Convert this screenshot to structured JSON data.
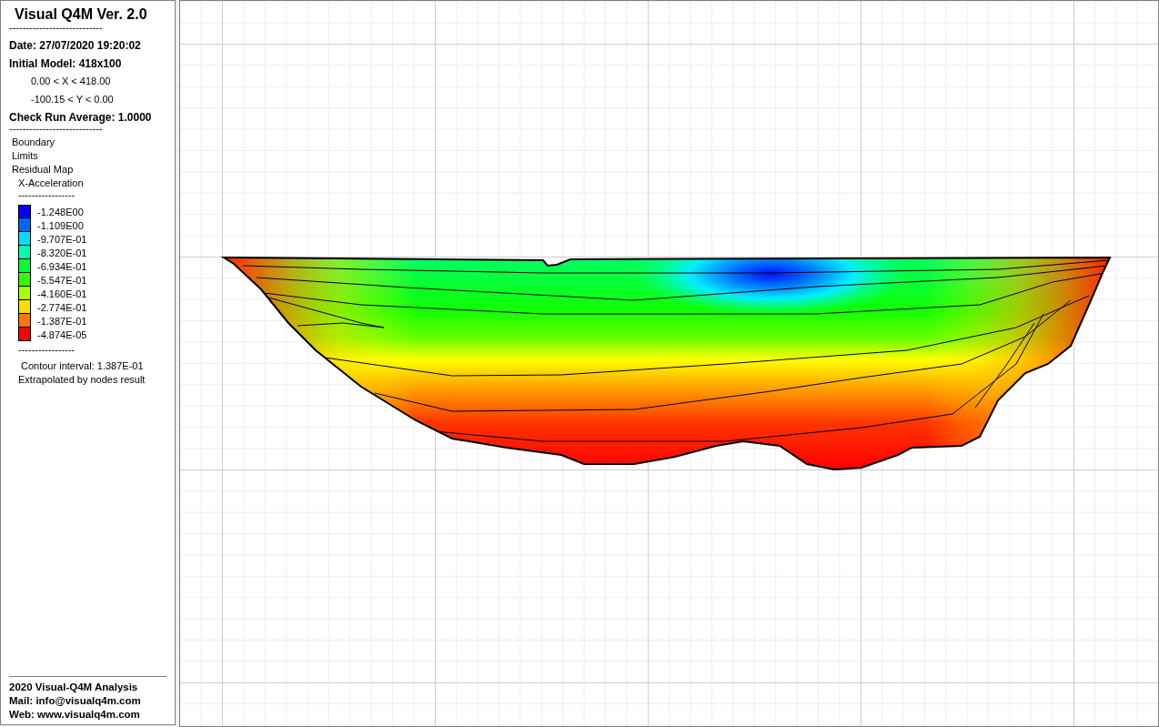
{
  "sidebar": {
    "title": "Visual Q4M Ver. 2.0",
    "rule_1": "----------------------------",
    "date": "Date: 27/07/2020 19:20:02",
    "model": "Initial Model: 418x100",
    "x_range": "0.00 < X < 418.00",
    "y_range": "-100.15 < Y < 0.00",
    "check_run": "Check Run Average: 1.0000",
    "rule_2": "----------------------------",
    "layers": [
      "Boundary",
      "Limits",
      "Residual Map"
    ],
    "variable": "X-Acceleration",
    "rule_3": "-----------------",
    "legend": [
      {
        "value": "-1.248E00",
        "color": "#0000ff"
      },
      {
        "value": "-1.109E00",
        "color": "#0066ff"
      },
      {
        "value": "-9.707E-01",
        "color": "#00ddff"
      },
      {
        "value": "-8.320E-01",
        "color": "#00ffaa"
      },
      {
        "value": "-6.934E-01",
        "color": "#00ff33"
      },
      {
        "value": "-5.547E-01",
        "color": "#33ff00"
      },
      {
        "value": "-4.160E-01",
        "color": "#aaff00"
      },
      {
        "value": "-2.774E-01",
        "color": "#ffdd00"
      },
      {
        "value": "-1.387E-01",
        "color": "#ff7700"
      },
      {
        "value": "-4.874E-05",
        "color": "#ff0000"
      }
    ],
    "rule_4": "-----------------",
    "contour_interval": "Contour interval: 1.387E-01",
    "note": "Extrapolated by nodes result",
    "footer": [
      "2020 Visual-Q4M Analysis",
      "Mail: info@visualq4m.com",
      "Web: www.visualq4m.com"
    ]
  }
}
